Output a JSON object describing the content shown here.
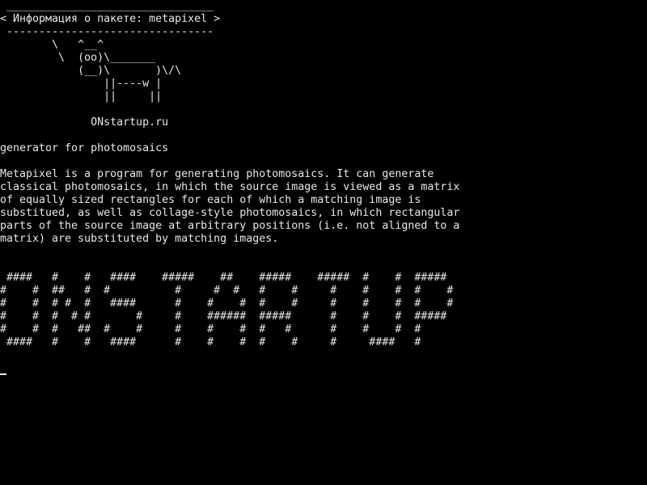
{
  "cowsay": {
    "border_top": " ________________________________",
    "message": "< Информация о пакете: metapixel >",
    "border_bottom": " --------------------------------",
    "cow": [
      "        \\   ^__^",
      "         \\  (oo)\\_______",
      "            (__)\\       )\\/\\",
      "                ||----w |",
      "                ||     ||"
    ],
    "site": "              ONstartup.ru"
  },
  "package": {
    "summary": "generator for photomosaics",
    "description": [
      "Metapixel is a program for generating photomosaics. It can generate",
      "classical photomosaics, in which the source image is viewed as a matrix",
      "of equally sized rectangles for each of which a matching image is",
      "substitued, as well as collage-style photomosaics, in which rectangular",
      "parts of the source image at arbitrary positions (i.e. not aligned to a",
      "matrix) are substituted by matching images."
    ]
  },
  "banner": [
    " ####   #    #   ####    #####    ##    #####    #####  #    #  #####",
    "#    #  ##   #  #          #     #  #   #    #     #    #    #  #    #",
    "#    #  # #  #   ####      #    #    #  #    #     #    #    #  #    #",
    "#    #  #  # #       #     #    ######  #####      #    #    #  #####",
    "#    #  #   ##  #    #     #    #    #  #   #      #    #    #  #",
    " ####   #    #   ####      #    #    #  #    #     #     ####   #"
  ]
}
